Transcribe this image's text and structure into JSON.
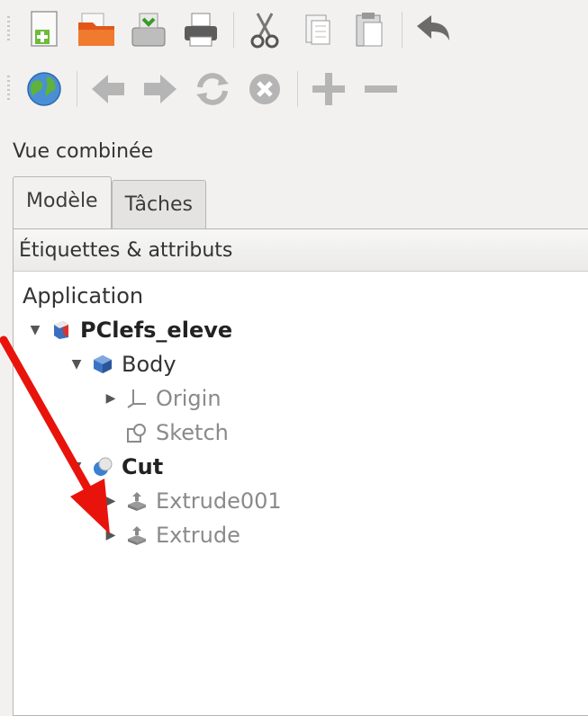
{
  "toolbar_top": {
    "buttons": [
      "new-document-icon",
      "open-folder-icon",
      "save-icon",
      "print-icon",
      "cut-icon",
      "copy-icon",
      "paste-icon",
      "undo-icon"
    ]
  },
  "toolbar_nav": {
    "buttons": [
      "web-globe-icon",
      "back-arrow-icon",
      "forward-arrow-icon",
      "refresh-icon",
      "stop-icon",
      "zoom-in-icon",
      "zoom-out-icon"
    ]
  },
  "panel": {
    "title": "Vue combinée",
    "tabs": [
      {
        "label": "Modèle",
        "active": true
      },
      {
        "label": "Tâches",
        "active": false
      }
    ]
  },
  "tree": {
    "header": "Étiquettes & attributs",
    "root": "Application",
    "items": [
      {
        "label": "PClefs_eleve",
        "expander": "▼",
        "icon": "document-part-icon"
      },
      {
        "label": "Body",
        "expander": "▼",
        "icon": "body-icon"
      },
      {
        "label": "Origin",
        "expander": "▶",
        "icon": "origin-axes-icon"
      },
      {
        "label": "Sketch",
        "expander": "",
        "icon": "sketch-icon"
      },
      {
        "label": "Cut",
        "expander": "▼",
        "icon": "cut-boolean-icon"
      },
      {
        "label": "Extrude001",
        "expander": "▶",
        "icon": "extrude-icon"
      },
      {
        "label": "Extrude",
        "expander": "▶",
        "icon": "extrude-icon"
      }
    ]
  },
  "annotation": {
    "color": "#e8140c",
    "icon": "annotation-arrow-icon"
  }
}
